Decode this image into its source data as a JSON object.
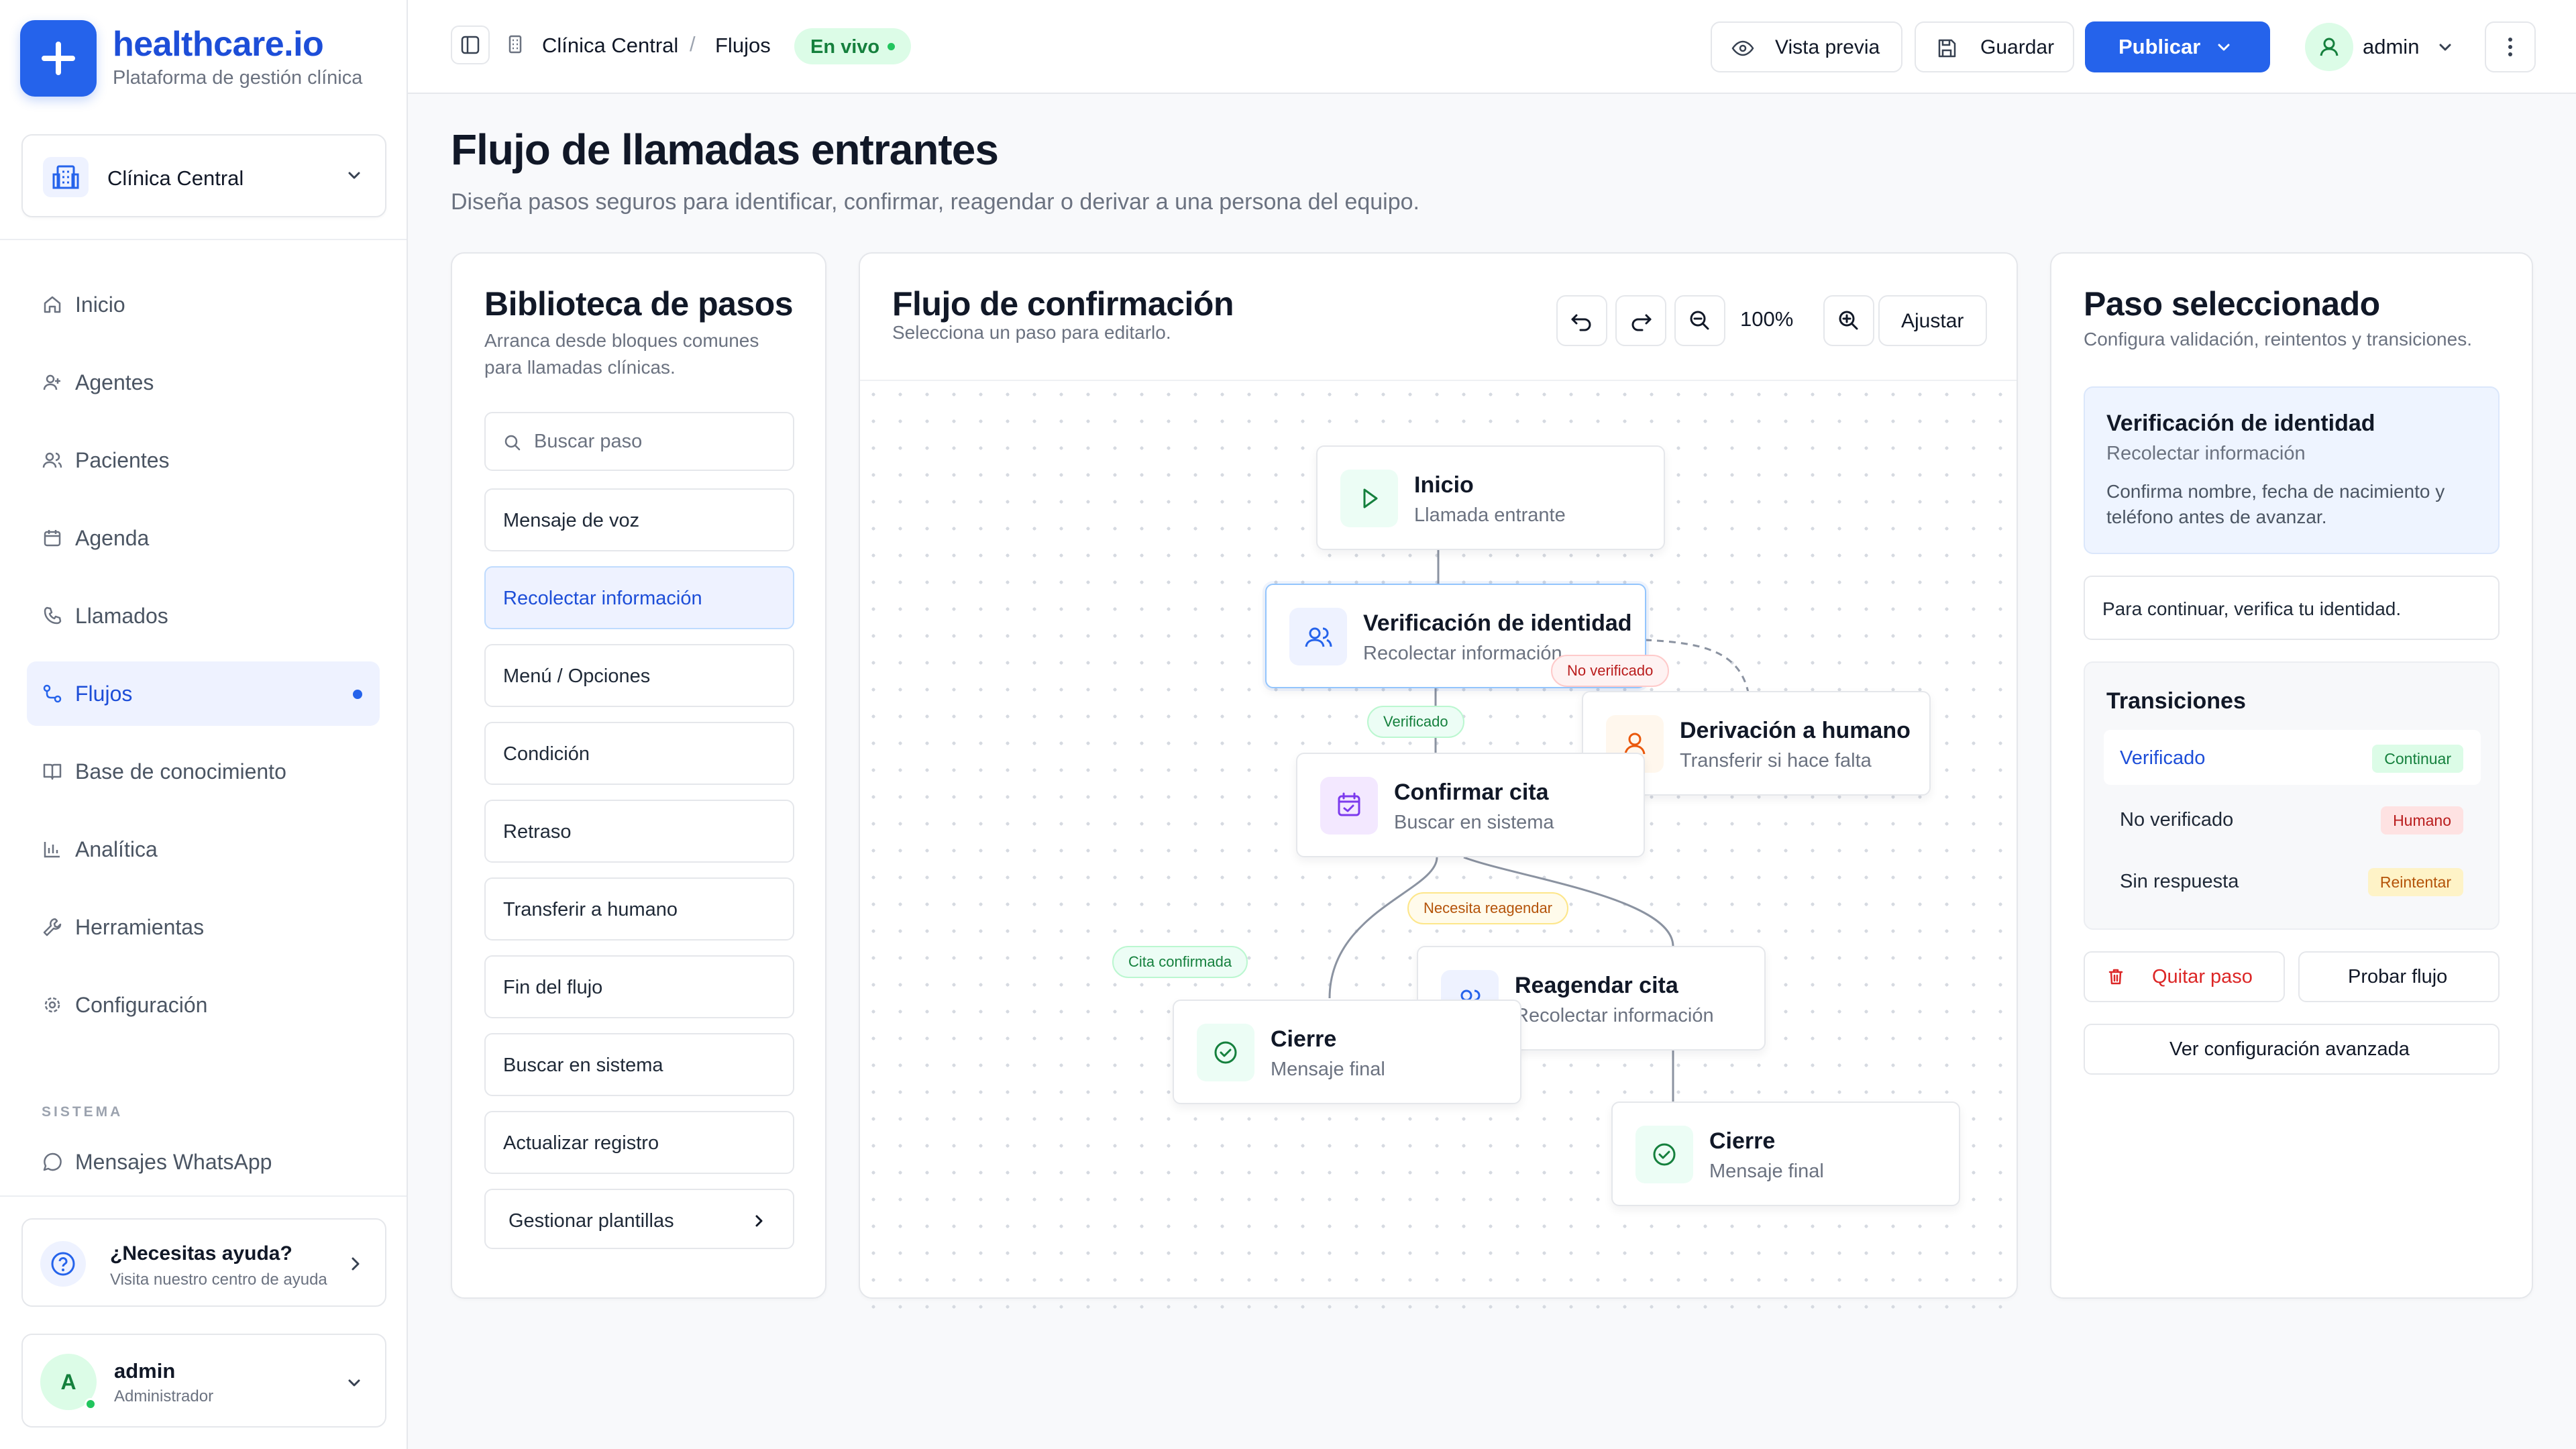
{
  "brand": {
    "title": "healthcare.io",
    "subtitle": "Plataforma de gestión clínica"
  },
  "clinic_selector": {
    "label": "Clínica Central"
  },
  "nav": {
    "items": [
      {
        "label": "Inicio",
        "icon": "home-icon"
      },
      {
        "label": "Agentes",
        "icon": "agents-icon"
      },
      {
        "label": "Pacientes",
        "icon": "patients-icon"
      },
      {
        "label": "Agenda",
        "icon": "calendar-icon"
      },
      {
        "label": "Llamados",
        "icon": "phone-icon"
      },
      {
        "label": "Flujos",
        "icon": "flow-icon",
        "active": true
      },
      {
        "label": "Base de conocimiento",
        "icon": "book-icon"
      },
      {
        "label": "Analítica",
        "icon": "chart-icon"
      },
      {
        "label": "Herramientas",
        "icon": "wrench-icon"
      },
      {
        "label": "Configuración",
        "icon": "gear-icon"
      }
    ],
    "section_label": "SISTEMA",
    "system_items": [
      {
        "label": "Mensajes WhatsApp",
        "icon": "chat-icon"
      }
    ]
  },
  "help": {
    "title": "¿Necesitas ayuda?",
    "subtitle": "Visita nuestro centro de ayuda"
  },
  "user": {
    "initial": "A",
    "name": "admin",
    "role": "Administrador"
  },
  "topbar": {
    "breadcrumb": [
      "Clínica Central",
      "Flujos"
    ],
    "breadcrumb_sep": "/",
    "status": "En vivo",
    "preview_label": "Vista previa",
    "save_label": "Guardar",
    "publish_label": "Publicar",
    "admin_name": "admin"
  },
  "page": {
    "title": "Flujo de llamadas entrantes",
    "subtitle": "Diseña pasos seguros para identificar, confirmar, reagendar o derivar a una persona del equipo."
  },
  "library": {
    "title": "Biblioteca de pasos",
    "subtitle": "Arranca desde bloques comunes para llamadas clínicas.",
    "search_placeholder": "Buscar paso",
    "items": [
      {
        "label": "Mensaje de voz"
      },
      {
        "label": "Recolectar información",
        "selected": true
      },
      {
        "label": "Menú / Opciones"
      },
      {
        "label": "Condición"
      },
      {
        "label": "Retraso"
      },
      {
        "label": "Transferir a humano"
      },
      {
        "label": "Fin del flujo"
      },
      {
        "label": "Buscar en sistema"
      },
      {
        "label": "Actualizar registro"
      }
    ],
    "manage_label": "Gestionar plantillas"
  },
  "flow": {
    "title": "Flujo de confirmación",
    "subtitle": "Selecciona un paso para editarlo.",
    "zoom": "100%",
    "fit_label": "Ajustar",
    "nodes": [
      {
        "title": "Inicio",
        "subtitle": "Llamada entrante",
        "icon": "play-icon"
      },
      {
        "title": "Verificación de identidad",
        "subtitle": "Recolectar información",
        "icon": "users-icon"
      },
      {
        "title": "Derivación a humano",
        "subtitle": "Transferir si hace falta",
        "icon": "person-icon"
      },
      {
        "title": "Confirmar cita",
        "subtitle": "Buscar en sistema",
        "icon": "calendar-check-icon"
      },
      {
        "title": "Reagendar cita",
        "subtitle": "Recolectar información",
        "icon": "users-icon"
      },
      {
        "title": "Cierre",
        "subtitle": "Mensaje final",
        "icon": "check-circle-icon"
      },
      {
        "title": "Cierre",
        "subtitle": "Mensaje final",
        "icon": "check-circle-icon"
      }
    ],
    "edge_labels": {
      "verified": "Verificado",
      "not_verified": "No verificado",
      "needs_reschedule": "Necesita reagendar",
      "confirmed": "Cita confirmada"
    }
  },
  "selected_panel": {
    "title": "Paso seleccionado",
    "subtitle": "Configura validación, reintentos y transiciones.",
    "step_title": "Verificación de identidad",
    "step_type": "Recolectar información",
    "step_desc": "Confirma nombre, fecha de nacimiento y teléfono antes de avanzar.",
    "message": "Para continuar, verifica tu identidad.",
    "transitions_title": "Transiciones",
    "transitions": [
      {
        "label": "Verificado",
        "action": "Continuar",
        "color": "green"
      },
      {
        "label": "No verificado",
        "action": "Humano",
        "color": "red"
      },
      {
        "label": "Sin respuesta",
        "action": "Reintentar",
        "color": "amber"
      }
    ],
    "remove_label": "Quitar paso",
    "test_label": "Probar flujo",
    "advanced_label": "Ver configuración avanzada"
  },
  "colors": {
    "accent": "#2563eb",
    "live": "#15803d",
    "danger": "#dc2626"
  }
}
